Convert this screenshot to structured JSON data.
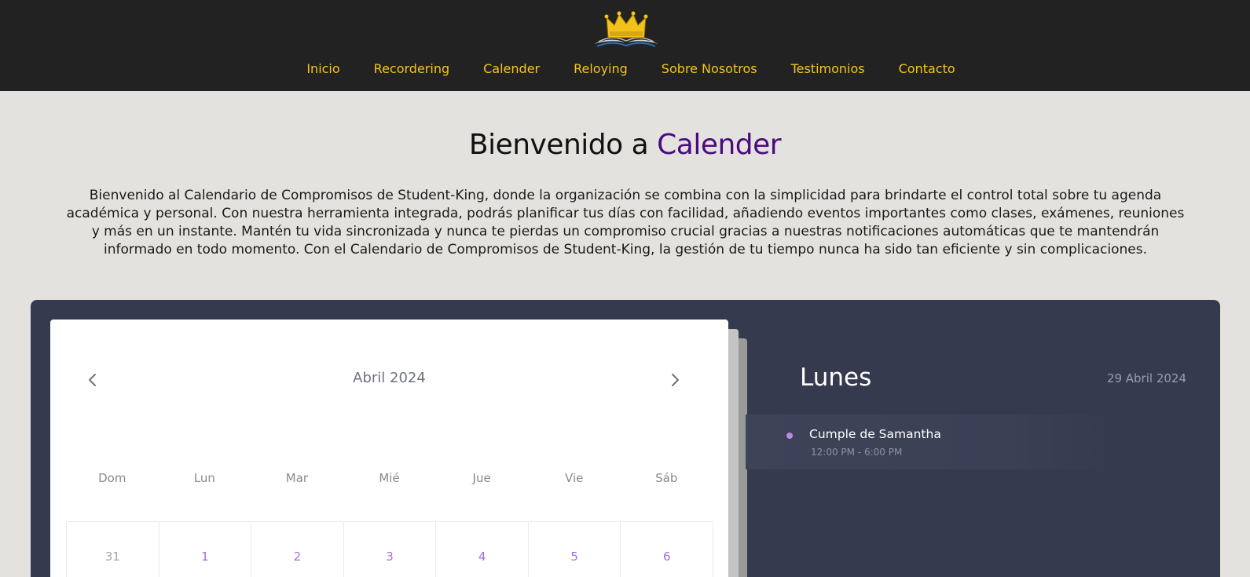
{
  "nav": {
    "items": [
      "Inicio",
      "Recordering",
      "Calender",
      "Reloying",
      "Sobre Nosotros",
      "Testimonios",
      "Contacto"
    ]
  },
  "logo": {
    "icon": "crown-book-logo"
  },
  "hero": {
    "title_prefix": "Bienvenido a ",
    "title_accent": "Calender",
    "intro": "Bienvenido al Calendario de Compromisos de Student-King, donde la organización se combina con la simplicidad para brindarte el control total sobre tu agenda académica y personal. Con nuestra herramienta integrada, podrás planificar tus días con facilidad, añadiendo eventos importantes como clases, exámenes, reuniones y más en un instante. Mantén tu vida sincronizada y nunca te pierdas un compromiso crucial gracias a nuestras notificaciones automáticas que te mantendrán informado en todo momento. Con el Calendario de Compromisos de Student-King, la gestión de tu tiempo nunca ha sido tan eficiente y sin complicaciones."
  },
  "calendar": {
    "month_label": "Abril 2024",
    "prev_icon": "chevron-left-icon",
    "next_icon": "chevron-right-icon",
    "weekdays": [
      "Dom",
      "Lun",
      "Mar",
      "Mié",
      "Jue",
      "Vie",
      "Sáb"
    ],
    "first_row": [
      "31",
      "1",
      "2",
      "3",
      "4",
      "5",
      "6"
    ]
  },
  "agenda": {
    "day_name": "Lunes",
    "date": "29 Abril 2024",
    "events": [
      {
        "title": "Cumple de Samantha",
        "time": "12:00 PM - 6:00 PM"
      }
    ]
  },
  "colors": {
    "nav_bg": "#222222",
    "nav_link": "#f5c518",
    "accent_purple": "#4b0a82",
    "panel_bg": "#363a4f",
    "day_number": "#a86bd9",
    "event_dot": "#b88ce6"
  }
}
